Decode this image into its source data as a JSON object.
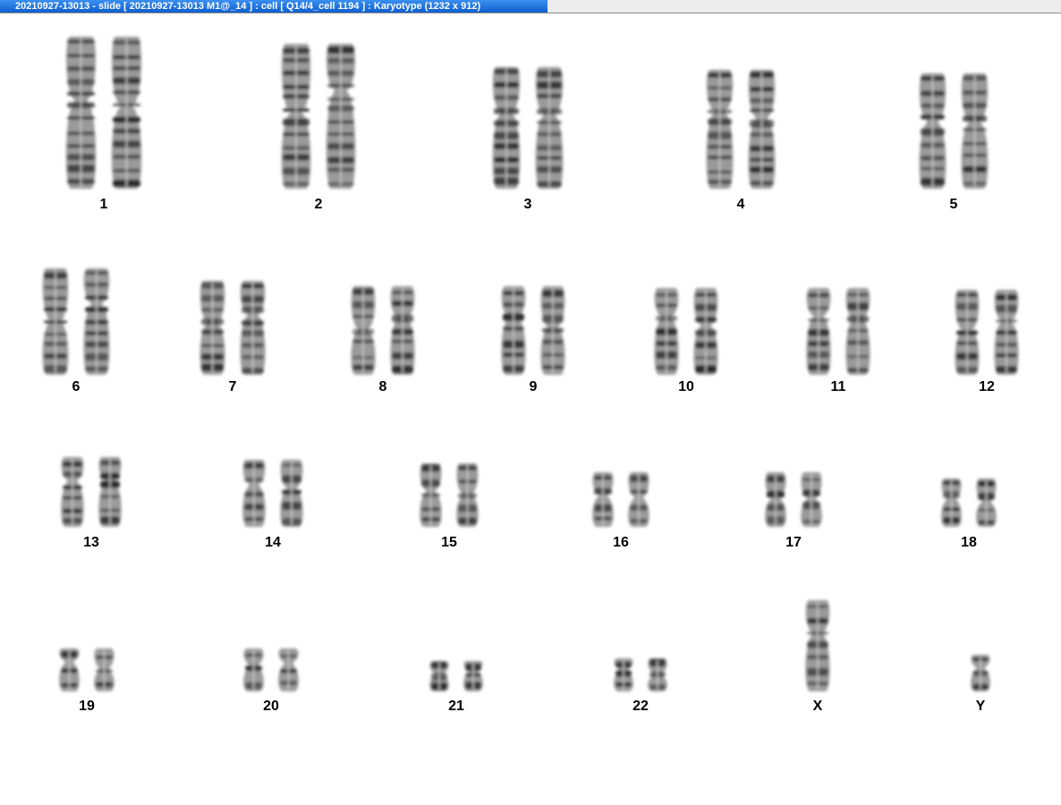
{
  "window": {
    "title": "20210927-13013 - slide [ 20210927-13013 M1@_14 ] : cell [ Q14/4_cell 1194 ] : Karyotype  (1232 x 912)",
    "titlebar_color": "#1a6fe0"
  },
  "karyotype": {
    "chromosome_color": "#2b2b2b",
    "groups": [
      {
        "label": "1",
        "id": "1",
        "relative_length": 1.0,
        "copies": 2
      },
      {
        "label": "2",
        "id": "2",
        "relative_length": 0.95,
        "copies": 2
      },
      {
        "label": "3",
        "id": "3",
        "relative_length": 0.8,
        "copies": 2
      },
      {
        "label": "4",
        "id": "4",
        "relative_length": 0.78,
        "copies": 2
      },
      {
        "label": "5",
        "id": "5",
        "relative_length": 0.76,
        "copies": 2
      },
      {
        "label": "6",
        "id": "6",
        "relative_length": 0.7,
        "copies": 2
      },
      {
        "label": "7",
        "id": "7",
        "relative_length": 0.62,
        "copies": 2
      },
      {
        "label": "8",
        "id": "8",
        "relative_length": 0.58,
        "copies": 2
      },
      {
        "label": "9",
        "id": "9",
        "relative_length": 0.58,
        "copies": 2
      },
      {
        "label": "10",
        "id": "10",
        "relative_length": 0.57,
        "copies": 2
      },
      {
        "label": "11",
        "id": "11",
        "relative_length": 0.57,
        "copies": 2
      },
      {
        "label": "12",
        "id": "12",
        "relative_length": 0.56,
        "copies": 2
      },
      {
        "label": "13",
        "id": "13",
        "relative_length": 0.46,
        "copies": 2
      },
      {
        "label": "14",
        "id": "14",
        "relative_length": 0.44,
        "copies": 2
      },
      {
        "label": "15",
        "id": "15",
        "relative_length": 0.42,
        "copies": 2
      },
      {
        "label": "16",
        "id": "16",
        "relative_length": 0.36,
        "copies": 2
      },
      {
        "label": "17",
        "id": "17",
        "relative_length": 0.36,
        "copies": 2
      },
      {
        "label": "18",
        "id": "18",
        "relative_length": 0.32,
        "copies": 2
      },
      {
        "label": "19",
        "id": "19",
        "relative_length": 0.28,
        "copies": 2
      },
      {
        "label": "20",
        "id": "20",
        "relative_length": 0.28,
        "copies": 2
      },
      {
        "label": "21",
        "id": "21",
        "relative_length": 0.2,
        "copies": 2
      },
      {
        "label": "22",
        "id": "22",
        "relative_length": 0.22,
        "copies": 2
      },
      {
        "label": "X",
        "id": "x",
        "relative_length": 0.6,
        "copies": 1
      },
      {
        "label": "Y",
        "id": "y",
        "relative_length": 0.24,
        "copies": 1
      }
    ]
  }
}
